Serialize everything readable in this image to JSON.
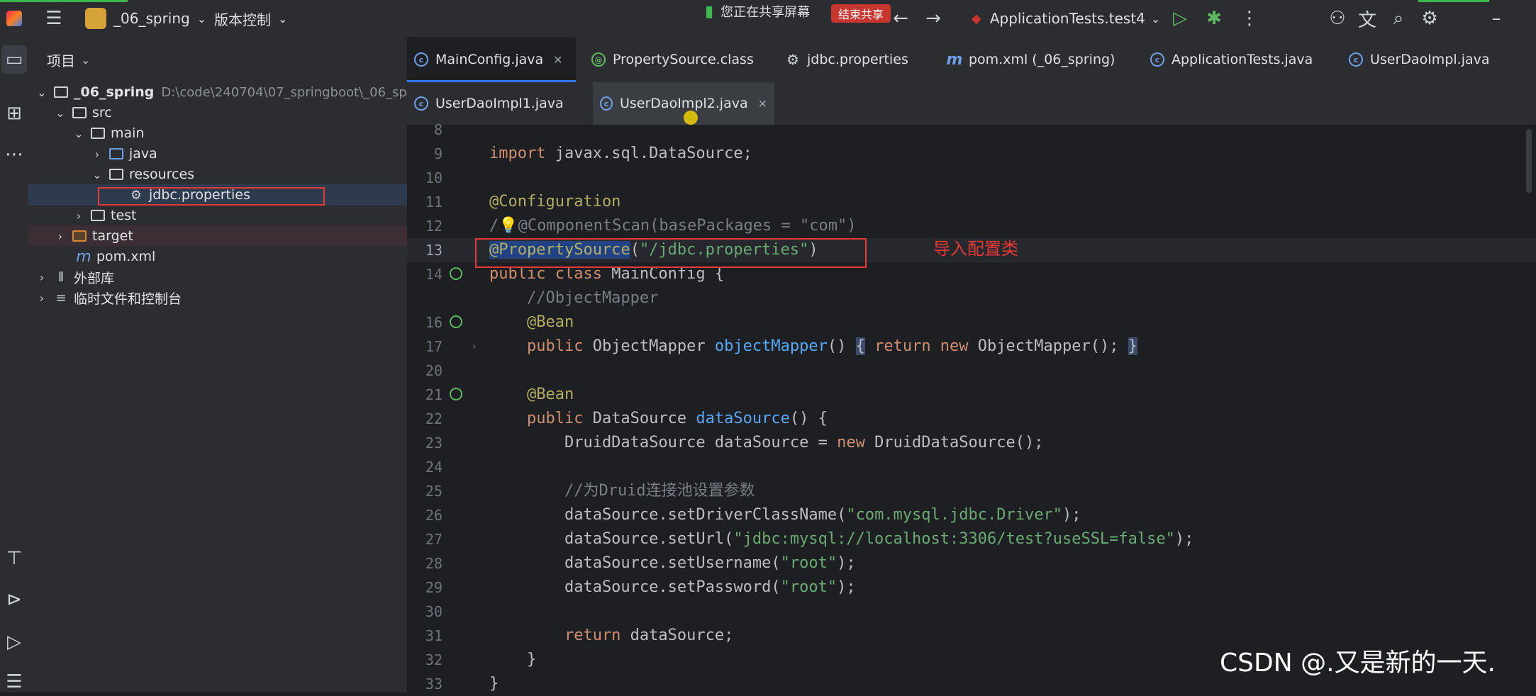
{
  "titlebar": {
    "project_name": "_06_spring",
    "vcs_label": "版本控制",
    "sharing_status": "您正在共享屏幕",
    "stop_share": "结束共享",
    "run_config": "ApplicationTests.test4",
    "icons": [
      "app-icon",
      "hamburger-icon",
      "back-icon",
      "forward-icon",
      "run-icon",
      "debug-icon",
      "more-icon",
      "add-user-icon",
      "translate-icon",
      "search-icon",
      "settings-icon",
      "minimize-icon"
    ]
  },
  "project_panel": {
    "title": "项目",
    "tree": [
      {
        "label": "_06_spring",
        "path": "D:\\code\\240704\\07_springboot\\_06_sp",
        "depth": 0,
        "expanded": true
      },
      {
        "label": "src",
        "depth": 1,
        "expanded": true
      },
      {
        "label": "main",
        "depth": 2,
        "expanded": true
      },
      {
        "label": "java",
        "depth": 3,
        "expanded": false
      },
      {
        "label": "resources",
        "depth": 3,
        "expanded": true
      },
      {
        "label": "jdbc.properties",
        "depth": 4
      },
      {
        "label": "test",
        "depth": 2,
        "expanded": false
      },
      {
        "label": "target",
        "depth": 1,
        "expanded": false
      },
      {
        "label": "pom.xml",
        "depth": 1
      },
      {
        "label": "外部库",
        "depth": 0,
        "expanded": false
      },
      {
        "label": "临时文件和控制台",
        "depth": 0,
        "expanded": false
      }
    ]
  },
  "tabs_row1": [
    {
      "label": "MainConfig.java",
      "active": true
    },
    {
      "label": "PropertySource.class"
    },
    {
      "label": "jdbc.properties"
    },
    {
      "label": "pom.xml (_06_spring)"
    },
    {
      "label": "ApplicationTests.java"
    },
    {
      "label": "UserDaoImpl.java"
    }
  ],
  "tabs_row2": [
    {
      "label": "UserDaoImpl1.java"
    },
    {
      "label": "UserDaoImpl2.java",
      "active": true
    }
  ],
  "code": {
    "line_numbers": [
      "8",
      "9",
      "10",
      "11",
      "12",
      "13",
      "14",
      "16",
      "17",
      "20",
      "21",
      "22",
      "23",
      "24",
      "25",
      "26",
      "27",
      "28",
      "29",
      "30",
      "31",
      "32",
      "33"
    ],
    "l9_import": "import",
    "l9_rest": " javax.sql.DataSource;",
    "l11": "@Configuration",
    "l12_a": "/",
    "l12_b": "@ComponentScan(basePackages = \"com\")",
    "l13_ann": "@PropertySource",
    "l13_rest_a": "(",
    "l13_str": "\"/jdbc.properties\"",
    "l13_rest_b": ")",
    "l14_kw": "public class",
    "l14_rest": " MainConfig {",
    "l15": "    //ObjectMapper",
    "l16": "    @Bean",
    "l17_kw": "    public",
    "l17_type": " ObjectMapper ",
    "l17_fn": "objectMapper",
    "l17_p": "()",
    "l17_b1": "{",
    "l17_kw2": "return new",
    "l17_rest": " ObjectMapper();",
    "l17_b2": "}",
    "l21": "    @Bean",
    "l22_kw": "    public",
    "l22_type": " DataSource ",
    "l22_fn": "dataSource",
    "l22_rest": "() {",
    "l23_a": "        DruidDataSource dataSource = ",
    "l23_kw": "new",
    "l23_b": " DruidDataSource();",
    "l25": "        //为Druid连接池设置参数",
    "l26_a": "        dataSource.setDriverClassName(",
    "l26_s": "\"com.mysql.jdbc.Driver\"",
    "l26_b": ");",
    "l27_a": "        dataSource.setUrl(",
    "l27_s": "\"jdbc:mysql://localhost:3306/test?useSSL=false\"",
    "l27_b": ");",
    "l28_a": "        dataSource.setUsername(",
    "l28_s": "\"root\"",
    "l28_b": ");",
    "l29_a": "        dataSource.setPassword(",
    "l29_s": "\"root\"",
    "l29_b": ");",
    "l31_kw": "        return",
    "l31_rest": " dataSource;",
    "l32": "    }",
    "l33": "}"
  },
  "annotation_text": "导入配置类",
  "watermark": "CSDN @.又是新的一天.",
  "colors": {
    "highlight_box": "#e53935",
    "keyword": "#cf8e6d",
    "annotation": "#b3ae60",
    "string": "#6aab73",
    "function": "#56a8f5",
    "comment": "#7a7e85"
  }
}
